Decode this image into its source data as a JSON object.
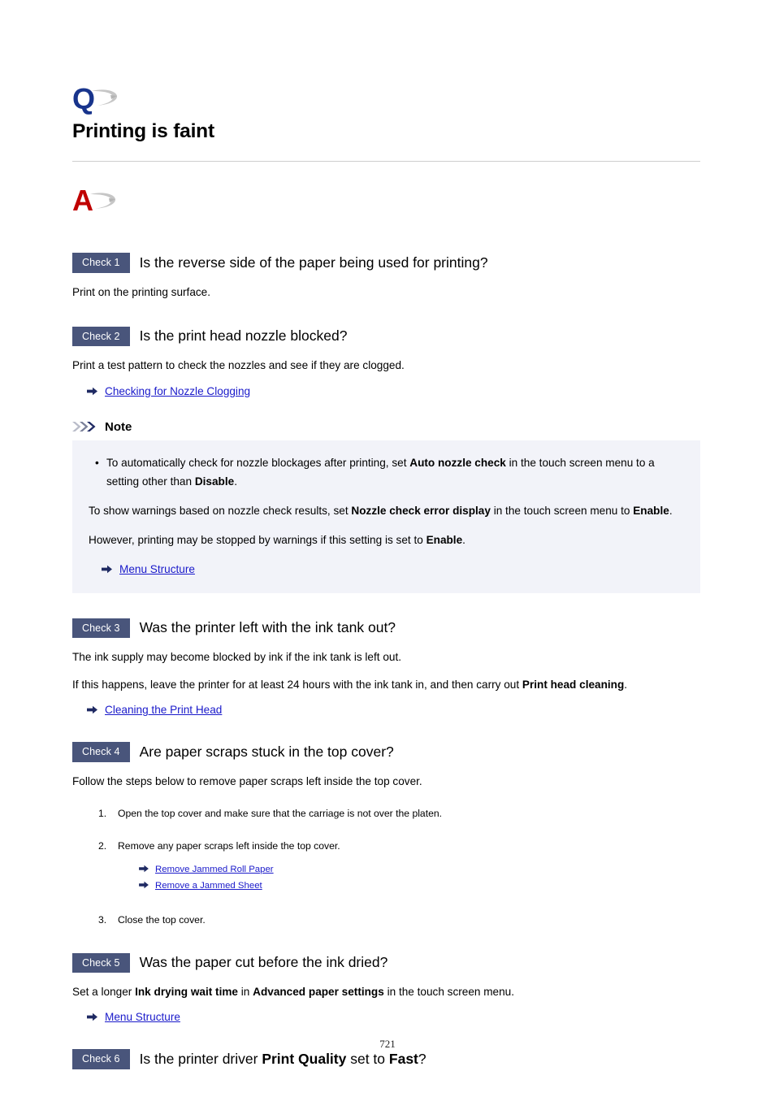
{
  "page": {
    "number": "721"
  },
  "question_emblem": {
    "letter": "Q",
    "icon_name": "question-emblem-icon",
    "color": "#18348c"
  },
  "answer_emblem": {
    "letter": "A",
    "icon_name": "answer-emblem-icon",
    "color": "#c00000"
  },
  "title": "Printing is faint",
  "checks": [
    {
      "badge": "Check 1",
      "question_html": "Is the reverse side of the paper being used for printing?",
      "body": "Print on the printing surface."
    },
    {
      "badge": "Check 2",
      "question_html": "Is the print head nozzle blocked?",
      "body": "Print a test pattern to check the nozzles and see if they are clogged.",
      "link": "Checking for Nozzle Clogging"
    },
    {
      "badge": "Check 3",
      "question_html": "Was the printer left with the ink tank out?",
      "body": "The ink supply may become blocked by ink if the ink tank is left out.",
      "body2_html": "If this happens, leave the printer for at least 24 hours with the ink tank in, and then carry out <b>Print head cleaning</b>.",
      "link": "Cleaning the Print Head"
    },
    {
      "badge": "Check 4",
      "question_html": "Are paper scraps stuck in the top cover?",
      "body": "Follow the steps below to remove paper scraps left inside the top cover.",
      "steps": [
        {
          "num": "1.",
          "text": "Open the top cover and make sure that the carriage is not over the platen."
        },
        {
          "num": "2.",
          "text": "Remove any paper scraps left inside the top cover.",
          "links": [
            "Remove Jammed Roll Paper",
            "Remove a Jammed Sheet"
          ]
        },
        {
          "num": "3.",
          "text": "Close the top cover."
        }
      ]
    },
    {
      "badge": "Check 5",
      "question_html": "Was the paper cut before the ink dried?",
      "body_html": "Set a longer <b>Ink drying wait time</b> in <b>Advanced paper settings</b> in the touch screen menu.",
      "link": "Menu Structure"
    },
    {
      "badge": "Check 6",
      "question_html": "Is the printer driver <b>Print Quality</b> set to <b>Fast</b>?"
    }
  ],
  "note": {
    "heading": "Note",
    "icon_name": "triple-chevron-icon",
    "background": "#f2f3f9",
    "bullet_html": "To automatically check for nozzle blockages after printing, set <b>Auto nozzle check</b> in the touch screen menu to a setting other than <b>Disable</b>.",
    "paragraph2_html": "To show warnings based on nozzle check results, set <b>Nozzle check error display</b> in the touch screen menu to <b>Enable</b>.",
    "paragraph3_html": "However, printing may be stopped by warnings if this setting is set to <b>Enable</b>.",
    "link": "Menu Structure"
  },
  "colors": {
    "badge_bg": "#49557b",
    "link": "#1a1aca",
    "note_bg": "#f2f3f9",
    "rule": "#cfcfcf"
  }
}
